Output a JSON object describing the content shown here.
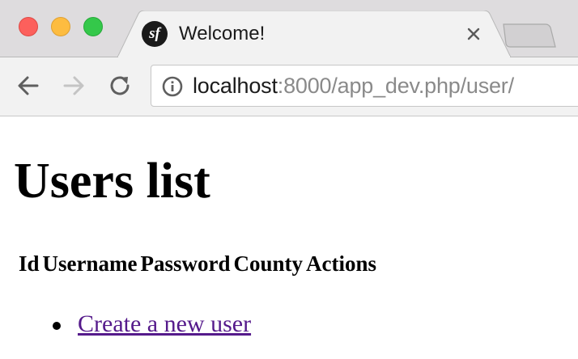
{
  "browser": {
    "tab": {
      "title": "Welcome!",
      "favicon_glyph": "sf",
      "favicon_icon": "symfony-logo-icon",
      "close_icon": "close-icon"
    },
    "toolbar": {
      "back_icon": "arrow-left-icon",
      "forward_icon": "arrow-right-icon",
      "reload_icon": "reload-icon",
      "info_icon": "info-icon"
    },
    "url": {
      "host": "localhost",
      "rest": ":8000/app_dev.php/user/"
    }
  },
  "page": {
    "title": "Users list",
    "table": {
      "headers": [
        "Id",
        "Username",
        "Password",
        "County",
        "Actions"
      ]
    },
    "links": [
      {
        "label": "Create a new user"
      }
    ]
  },
  "colors": {
    "tabstrip_bg": "#dedcde",
    "toolbar_bg": "#f2f2f2",
    "visited_link": "#551a8b",
    "traffic_red": "#fc605c",
    "traffic_yellow": "#fdbc40",
    "traffic_green": "#34c84a"
  }
}
